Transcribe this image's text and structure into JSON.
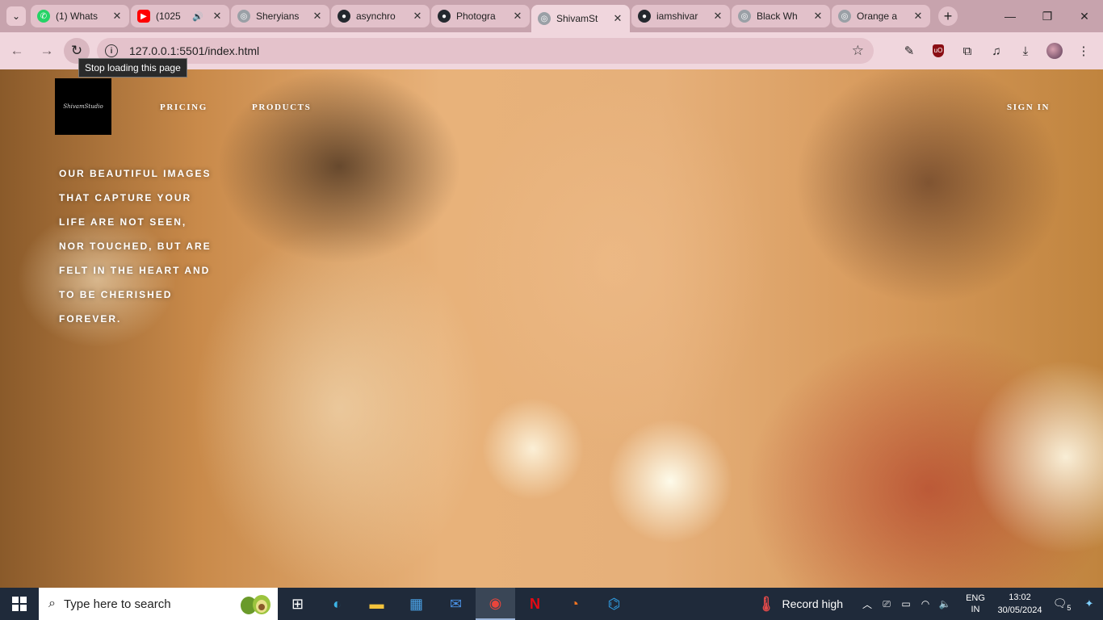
{
  "browser": {
    "tabs": [
      {
        "title": "(1) Whats",
        "favicon": "whatsapp-icon",
        "color": "#25d366",
        "active": false
      },
      {
        "title": "(1025",
        "favicon": "youtube-icon",
        "color": "#ff0000",
        "active": false,
        "audio": true
      },
      {
        "title": "Sheryians",
        "favicon": "globe-icon",
        "color": "#9aa0a6",
        "active": false
      },
      {
        "title": "asynchro",
        "favicon": "github-icon",
        "color": "#24292f",
        "active": false
      },
      {
        "title": "Photogra",
        "favicon": "github-icon",
        "color": "#24292f",
        "active": false
      },
      {
        "title": "ShivamSt",
        "favicon": "globe-icon",
        "color": "#9aa0a6",
        "active": true
      },
      {
        "title": "iamshivar",
        "favicon": "github-icon",
        "color": "#24292f",
        "active": false
      },
      {
        "title": "Black Wh",
        "favicon": "globe-icon",
        "color": "#9aa0a6",
        "active": false
      },
      {
        "title": "Orange a",
        "favicon": "globe-icon",
        "color": "#9aa0a6",
        "active": false
      }
    ],
    "url": "127.0.0.1:5501/index.html",
    "tooltip": "Stop loading this page"
  },
  "page": {
    "logo_text": "ShivamStudio",
    "nav": {
      "pricing": "PRICING",
      "products": "PRODUCTS",
      "sign_in": "SIGN IN"
    },
    "hero_lines": [
      "OUR BEAUTIFUL IMAGES",
      "THAT CAPTURE YOUR",
      "LIFE ARE NOT SEEN,",
      "NOR TOUCHED, BUT ARE",
      "FELT IN THE HEART AND",
      "TO BE CHERISHED",
      "FOREVER."
    ]
  },
  "taskbar": {
    "search_placeholder": "Type here to search",
    "apps": [
      "task-view-icon",
      "edge-icon",
      "file-explorer-icon",
      "store-icon",
      "mail-icon",
      "chrome-icon",
      "netflix-icon",
      "crunchyroll-icon",
      "vscode-icon"
    ],
    "weather_text": "Record high",
    "lang_line1": "ENG",
    "lang_line2": "IN",
    "time": "13:02",
    "date": "30/05/2024",
    "notification_count": "5"
  }
}
